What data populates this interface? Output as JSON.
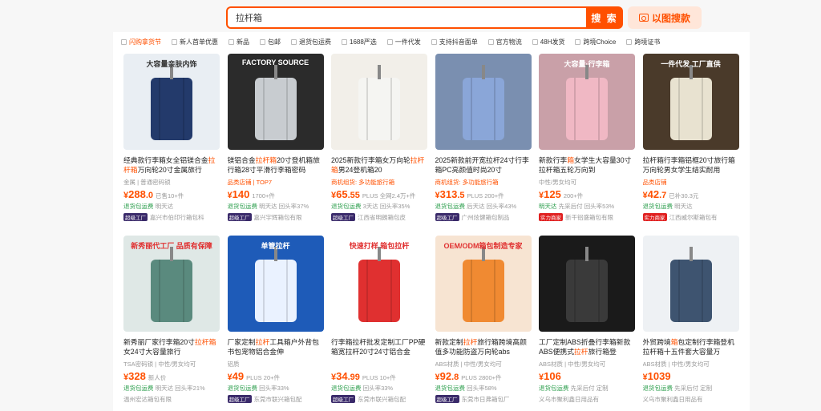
{
  "search": {
    "value": "拉杆箱",
    "button_label": "搜 索",
    "image_search_label": "以图搜款"
  },
  "filters": [
    "闪购拿货节",
    "新人首单优惠",
    "新品",
    "包邮",
    "退货包运费",
    "1688严选",
    "一件代发",
    "支持抖音面单",
    "官方物流",
    "48H发货",
    "跨境Choice",
    "跨境证书"
  ],
  "products": [
    {
      "title_pre": "经典款行李箱女全铝镁合金",
      "title_hl": "拉杆箱",
      "title_post": "万向轮20寸金属旅行",
      "meta": "金属 | 普通密码锁",
      "price_int": "288",
      "price_dec": ".0",
      "sold": "已售10+件",
      "tag1": "退货包运费",
      "tag2": "明天达",
      "shop": "嘉兴市伯印行箱包科",
      "badge": "超级工厂",
      "img_label": "大容量亲肤内饰",
      "colors": [
        "#e9eef3",
        "#233a6b"
      ]
    },
    {
      "title_pre": "镁铝合金",
      "title_hl": "拉杆箱",
      "title_post": "20寸登机箱旅行箱28寸平滑行李箱密码",
      "meta": "品类店铺 | TOP7",
      "price_int": "140",
      "price_dec": "",
      "sold": "1700+件",
      "tag1": "退货包运费",
      "tag2": "明天达  回头率37%",
      "shop": "嘉兴宇辉箱包有限",
      "badge": "超级工厂",
      "img_label": "FACTORY SOURCE",
      "colors": [
        "#2b2b2b",
        "#c8ccd0"
      ]
    },
    {
      "title_pre": "2025新款行李箱女万向轮",
      "title_hl": "拉杆箱",
      "title_post": "男24登机箱20",
      "meta": "商机组货: 多功能旅行箱",
      "price_int": "65",
      "price_dec": ".55",
      "sold": "PLUS 全网2.4万+件",
      "tag1": "退货包运费",
      "tag2": "3天达  回头率35%",
      "shop": "江西省明朗箱包皮",
      "badge": "超级工厂",
      "img_label": "",
      "colors": [
        "#f2efe9",
        "#f5f5f2"
      ]
    },
    {
      "title_pre": "2025新款前开宽拉杆24寸行李箱PC亮颜值时尚20寸",
      "title_hl": "",
      "title_post": "",
      "meta": "商机组货: 多功能旅行箱",
      "price_int": "313",
      "price_dec": ".5",
      "sold": "PLUS 200+件",
      "tag1": "退货包运费",
      "tag2": "后天达  回头率43%",
      "shop": "广州炫健箱包制品",
      "badge": "超级工厂",
      "img_label": "",
      "colors": [
        "#7a8fb0",
        "#8aa6d8"
      ]
    },
    {
      "title_pre": "新款行李",
      "title_hl": "箱",
      "title_post": "女学生大容量30寸拉杆箱五轮万向到",
      "meta": "中性/男女均可",
      "price_int": "125",
      "price_dec": "",
      "sold": "200+件",
      "tag1": "明天达",
      "tag2": "先采后付  回头率53%",
      "shop": "新干铝盛箱包有限",
      "badge": "实力商家",
      "img_label": "大容量·行李箱",
      "colors": [
        "#c9a0a8",
        "#f0b8c4"
      ]
    },
    {
      "title_pre": "拉杆箱行李箱铝框20寸旅行箱万向轮男女学生结实耐用",
      "title_hl": "",
      "title_post": "",
      "meta": "品类店铺",
      "price_int": "42",
      "price_dec": ".7",
      "sold": "已补30.3元",
      "tag1": "退货包运费",
      "tag2": "明天达",
      "shop": "江西威尔斯箱包有",
      "badge": "实力商家",
      "img_label": "一件代发 工厂直供",
      "colors": [
        "#4a3a2a",
        "#e8e2d0"
      ]
    },
    {
      "title_pre": "新秀丽厂家行李箱20寸",
      "title_hl": "拉杆箱",
      "title_post": "女24寸大容量旅行",
      "meta": "TSA密码锁 | 中性/男女均可",
      "price_int": "328",
      "price_dec": "",
      "sold": "新人价",
      "tag1": "退货包运费",
      "tag2": "明天达  回头率21%",
      "shop": "温州宏达箱包有限",
      "badge": "",
      "img_label": "新秀丽代工厂 品质有保障",
      "colors": [
        "#dfe8e6",
        "#5a8a7e"
      ]
    },
    {
      "title_pre": "厂家定制",
      "title_hl": "拉杆",
      "title_post": "工具箱户外背包书包宠物铝合金伸",
      "meta": "铝质",
      "price_int": "49",
      "price_dec": "",
      "sold": "PLUS 20+件",
      "tag1": "退货包运费",
      "tag2": "回头率33%",
      "shop": "东莞市联兴箱包配",
      "badge": "超级工厂",
      "img_label": "单管拉杆",
      "colors": [
        "#1e5bb8",
        "#eaf2ff"
      ]
    },
    {
      "title_pre": "行李箱拉杆批发定制工厂PP硬箱宽拉杆20寸24寸铝合金",
      "title_hl": "",
      "title_post": "",
      "meta": "",
      "price_int": "34",
      "price_dec": ".99",
      "sold": "PLUS 10+件",
      "tag1": "退货包运费",
      "tag2": "回头率33%",
      "shop": "东莞市联兴箱包配",
      "badge": "超级工厂",
      "img_label": "快速打样 箱包拉杆",
      "colors": [
        "#ffffff",
        "#e03030"
      ]
    },
    {
      "title_pre": "新款定制",
      "title_hl": "拉杆",
      "title_post": "旅行箱跨境高颜值多功能防盗万向轮abs",
      "meta": "ABS材质 | 中性/男女均可",
      "price_int": "92",
      "price_dec": ".8",
      "sold": "PLUS 2800+件",
      "tag1": "退货包运费",
      "tag2": "回头率58%",
      "shop": "东莞市日弗箱包厂",
      "badge": "超级工厂",
      "img_label": "OEM/ODM箱包制造专家",
      "colors": [
        "#f7e4d2",
        "#f08a32"
      ]
    },
    {
      "title_pre": "工厂定制ABS折叠行李箱新款ABS便携式",
      "title_hl": "拉杆",
      "title_post": "旅行箱登",
      "meta": "ABS材质 | 中性/男女均可",
      "price_int": "106",
      "price_dec": "",
      "sold": "",
      "tag1": "退货包运费",
      "tag2": "先采后付  定制",
      "shop": "义乌市聚利鑫日用品有",
      "badge": "",
      "img_label": "",
      "colors": [
        "#1a1a1a",
        "#3a3a3a"
      ]
    },
    {
      "title_pre": "外贸跨境",
      "title_hl": "箱",
      "title_post": "包定制行李箱登机拉杆箱十五件套大容量万",
      "meta": "ABS材质 | 中性/男女均可",
      "price_int": "1039",
      "price_dec": "",
      "sold": "",
      "tag1": "退货包运费",
      "tag2": "先采后付  定制",
      "shop": "义乌市聚利鑫日用品有",
      "badge": "",
      "img_label": "",
      "colors": [
        "#eef1f4",
        "#3e5470"
      ]
    }
  ],
  "currency": "¥"
}
